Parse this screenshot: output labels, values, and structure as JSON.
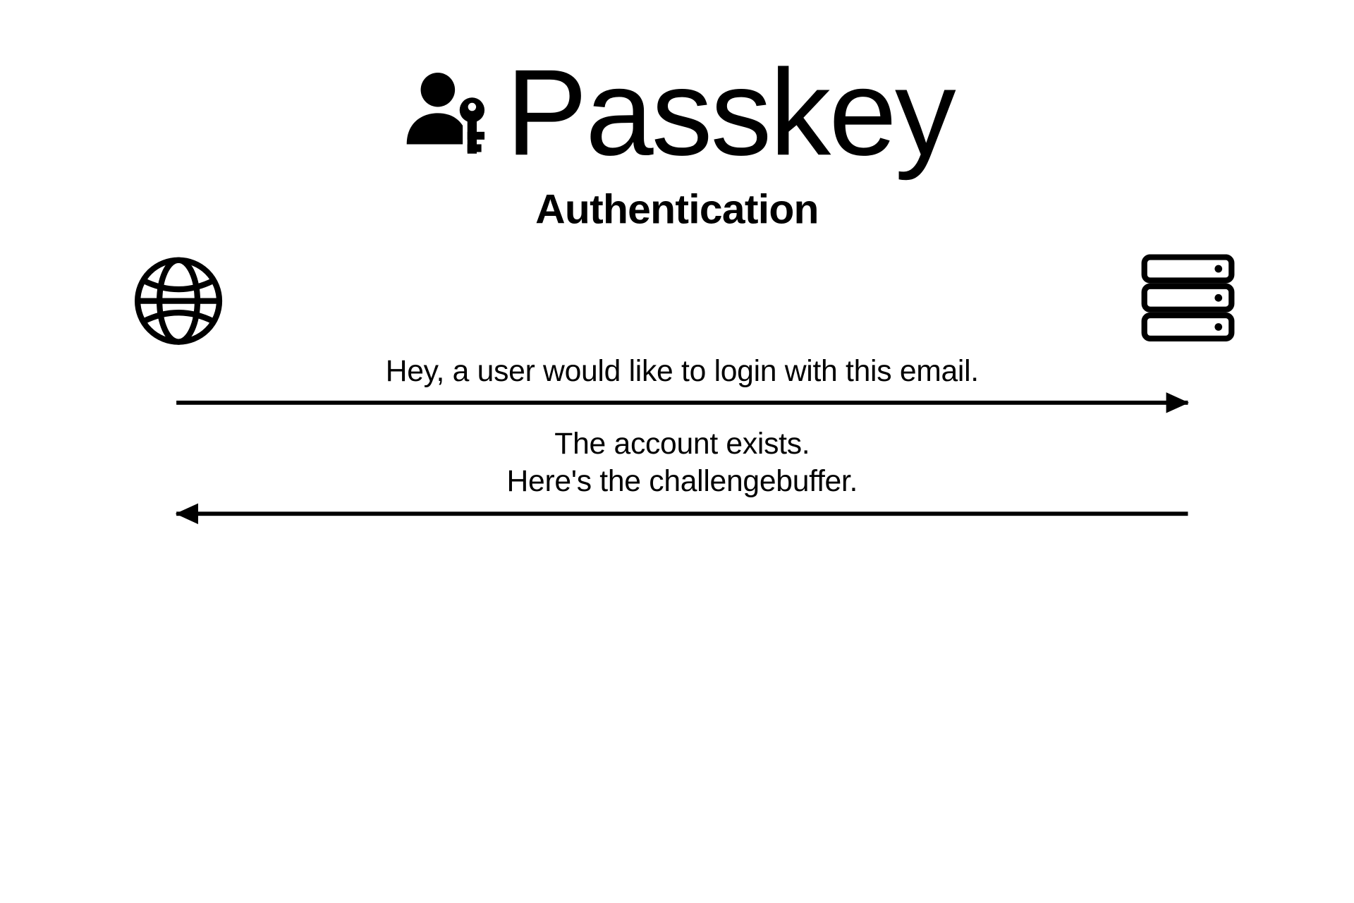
{
  "header": {
    "title": "Passkey",
    "subtitle": "Authentication",
    "icon": "passkey-icon"
  },
  "actors": {
    "left": {
      "icon": "globe-icon",
      "role": "client"
    },
    "right": {
      "icon": "server-icon",
      "role": "server"
    }
  },
  "messages": [
    {
      "direction": "right",
      "text": "Hey, a user would like to login with this email."
    },
    {
      "direction": "left",
      "text": "The account exists.\nHere's the challengebuffer."
    }
  ]
}
